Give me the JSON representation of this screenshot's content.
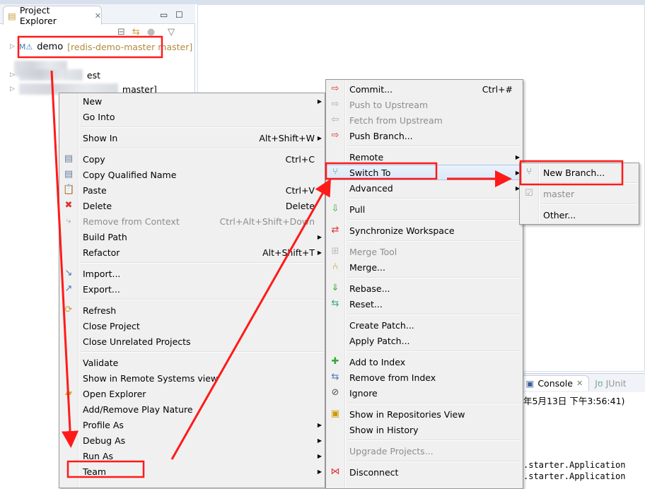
{
  "explorer": {
    "tab_title": "Project Explorer",
    "project_name": "demo",
    "project_repo": "[redis-demo-master master]",
    "row2_suffix": "est",
    "row3_suffix": "master]"
  },
  "console": {
    "tab_label": "Console",
    "junit_label": "JUnit",
    "header_text": "年5月13日 下午3:56:41)",
    "lines": [
      ".starter.Application",
      ".starter.Application"
    ]
  },
  "context_menu": {
    "items": [
      {
        "label": "New",
        "submenu": true
      },
      {
        "label": "Go Into"
      },
      {
        "sep": true
      },
      {
        "label": "Show In",
        "shortcut": "Alt+Shift+W",
        "submenu": true
      },
      {
        "sep": true
      },
      {
        "label": "Copy",
        "shortcut": "Ctrl+C",
        "icon": "copy-icon",
        "glyph": "▤",
        "color": "#6a7fa0"
      },
      {
        "label": "Copy Qualified Name",
        "icon": "copy-qualified-icon",
        "glyph": "▤",
        "color": "#6a7fa0"
      },
      {
        "label": "Paste",
        "shortcut": "Ctrl+V",
        "icon": "paste-icon",
        "glyph": "📋",
        "color": "#b08a40"
      },
      {
        "label": "Delete",
        "shortcut": "Delete",
        "icon": "delete-icon",
        "glyph": "✖",
        "color": "#d33"
      },
      {
        "label": "Remove from Context",
        "shortcut": "Ctrl+Alt+Shift+Down",
        "disabled": true,
        "icon": "remove-context-icon",
        "glyph": "⤷",
        "color": "#aaa"
      },
      {
        "label": "Build Path",
        "submenu": true
      },
      {
        "label": "Refactor",
        "shortcut": "Alt+Shift+T",
        "submenu": true
      },
      {
        "sep": true
      },
      {
        "label": "Import...",
        "icon": "import-icon",
        "glyph": "↘",
        "color": "#4a78b8"
      },
      {
        "label": "Export...",
        "icon": "export-icon",
        "glyph": "↗",
        "color": "#4a78b8"
      },
      {
        "sep": true
      },
      {
        "label": "Refresh",
        "icon": "refresh-icon",
        "glyph": "⟳",
        "color": "#c9a040"
      },
      {
        "label": "Close Project"
      },
      {
        "label": "Close Unrelated Projects"
      },
      {
        "sep": true
      },
      {
        "label": "Validate"
      },
      {
        "label": "Show in Remote Systems view"
      },
      {
        "label": "Open Explorer",
        "icon": "folder-icon",
        "glyph": "▰",
        "color": "#d9a530"
      },
      {
        "label": "Add/Remove Play Nature"
      },
      {
        "label": "Profile As",
        "submenu": true
      },
      {
        "label": "Debug As",
        "submenu": true
      },
      {
        "label": "Run As",
        "submenu": true
      },
      {
        "label": "Team",
        "submenu": true
      }
    ]
  },
  "team_menu": {
    "items": [
      {
        "label": "Commit...",
        "shortcut": "Ctrl+#",
        "icon": "commit-icon",
        "glyph": "⇨",
        "color": "#d33"
      },
      {
        "label": "Push to Upstream",
        "disabled": true,
        "icon": "push-upstream-icon",
        "glyph": "⇨",
        "color": "#aaa"
      },
      {
        "label": "Fetch from Upstream",
        "disabled": true,
        "icon": "fetch-upstream-icon",
        "glyph": "⇦",
        "color": "#aaa"
      },
      {
        "label": "Push Branch...",
        "icon": "push-branch-icon",
        "glyph": "⇨",
        "color": "#d33"
      },
      {
        "sep": true
      },
      {
        "label": "Remote",
        "submenu": true
      },
      {
        "label": "Switch To",
        "submenu": true,
        "highlighted": true,
        "icon": "switch-branch-icon",
        "glyph": "⑂",
        "color": "#4a8aa0"
      },
      {
        "label": "Advanced",
        "submenu": true
      },
      {
        "sep": true
      },
      {
        "label": "Pull",
        "icon": "pull-icon",
        "glyph": "⇩",
        "color": "#3a3"
      },
      {
        "sep": true
      },
      {
        "label": "Synchronize Workspace",
        "icon": "synchronize-icon",
        "glyph": "⇄",
        "color": "#d33"
      },
      {
        "sep": true
      },
      {
        "label": "Merge Tool",
        "disabled": true,
        "icon": "merge-tool-icon",
        "glyph": "⊞",
        "color": "#bbb"
      },
      {
        "label": "Merge...",
        "icon": "merge-icon",
        "glyph": "⑃",
        "color": "#c80"
      },
      {
        "sep": true
      },
      {
        "label": "Rebase...",
        "icon": "rebase-icon",
        "glyph": "⇓",
        "color": "#3a3"
      },
      {
        "label": "Reset...",
        "icon": "reset-icon",
        "glyph": "⇆",
        "color": "#3a8"
      },
      {
        "sep": true
      },
      {
        "label": "Create Patch..."
      },
      {
        "label": "Apply Patch..."
      },
      {
        "sep": true
      },
      {
        "label": "Add to Index",
        "icon": "add-index-icon",
        "glyph": "✚",
        "color": "#3a3"
      },
      {
        "label": "Remove from Index",
        "icon": "remove-index-icon",
        "glyph": "⇆",
        "color": "#4a78b8"
      },
      {
        "label": "Ignore",
        "icon": "ignore-icon",
        "glyph": "⊘",
        "color": "#555"
      },
      {
        "sep": true
      },
      {
        "label": "Show in Repositories View",
        "icon": "git-repo-icon",
        "glyph": "▣",
        "color": "#c90"
      },
      {
        "label": "Show in History"
      },
      {
        "sep": true
      },
      {
        "label": "Upgrade Projects...",
        "disabled": true
      },
      {
        "sep": true
      },
      {
        "label": "Disconnect",
        "icon": "disconnect-icon",
        "glyph": "⋈",
        "color": "#d33"
      }
    ]
  },
  "switch_menu": {
    "items": [
      {
        "label": "New Branch...",
        "icon": "new-branch-icon",
        "glyph": "⑂",
        "color": "#4a8aa0"
      },
      {
        "sep": true
      },
      {
        "label": "master",
        "disabled": true,
        "icon": "branch-checked-icon",
        "glyph": "☑",
        "color": "#aaa"
      },
      {
        "sep": true
      },
      {
        "label": "Other..."
      }
    ]
  },
  "annotation_color": "#ff1a1a"
}
